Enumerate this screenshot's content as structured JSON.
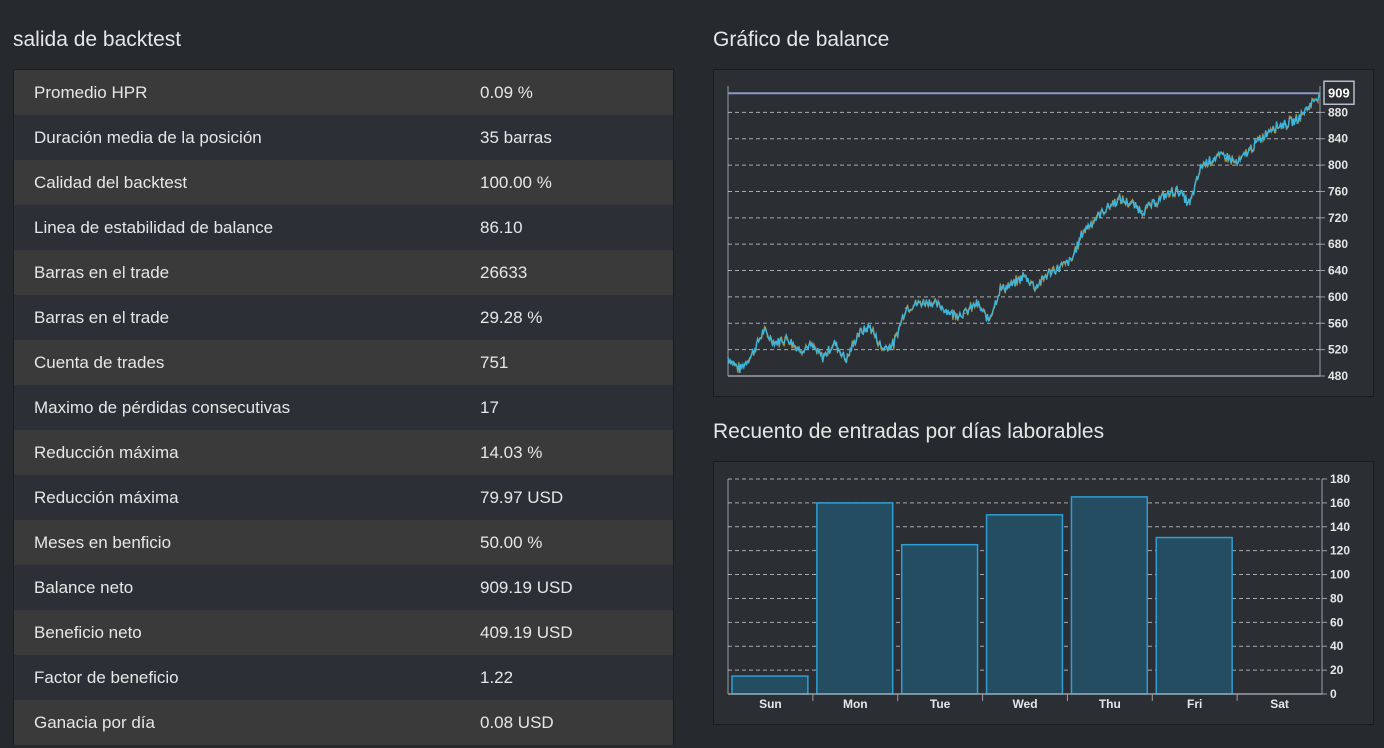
{
  "left_panel": {
    "title": "salida de backtest",
    "rows": [
      {
        "label": "Promedio HPR",
        "value": "0.09 %"
      },
      {
        "label": "Duración media de la posición",
        "value": "35 barras"
      },
      {
        "label": "Calidad del backtest",
        "value": "100.00 %"
      },
      {
        "label": "Linea de estabilidad de balance",
        "value": "86.10"
      },
      {
        "label": "Barras en el trade",
        "value": "26633"
      },
      {
        "label": "Barras en el trade",
        "value": "29.28 %"
      },
      {
        "label": "Cuenta de trades",
        "value": "751"
      },
      {
        "label": "Maximo de pérdidas consecutivas",
        "value": "17"
      },
      {
        "label": "Reducción máxima",
        "value": "14.03 %"
      },
      {
        "label": "Reducción máxima",
        "value": "79.97 USD"
      },
      {
        "label": "Meses en benficio",
        "value": "50.00 %"
      },
      {
        "label": "Balance neto",
        "value": "909.19 USD"
      },
      {
        "label": "Beneficio neto",
        "value": "409.19 USD"
      },
      {
        "label": "Factor de beneficio",
        "value": "1.22"
      },
      {
        "label": "Ganacia por día",
        "value": "0.08 USD"
      }
    ]
  },
  "chart_data": [
    {
      "type": "line",
      "title": "Gráfico de balance",
      "ylim": [
        480,
        920
      ],
      "yticks": [
        480,
        520,
        560,
        600,
        640,
        680,
        720,
        760,
        800,
        840,
        880
      ],
      "grid": true,
      "last_value_label": "909",
      "last_value": 909,
      "line_color": "#3cb6dc",
      "noise_color": "#d89a2e",
      "x": [
        0,
        2,
        4,
        6,
        8,
        10,
        12,
        14,
        16,
        18,
        20,
        22,
        24,
        26,
        28,
        30,
        32,
        34,
        36,
        38,
        40,
        42,
        44,
        46,
        48,
        50,
        52,
        54,
        56,
        58,
        60,
        62,
        64,
        66,
        68,
        70,
        72,
        74,
        76,
        78,
        80,
        82,
        84,
        86,
        88,
        90,
        92,
        94,
        96,
        98,
        100
      ],
      "y": [
        508,
        490,
        512,
        548,
        530,
        538,
        520,
        526,
        508,
        530,
        505,
        544,
        555,
        522,
        528,
        583,
        590,
        593,
        585,
        574,
        575,
        590,
        565,
        612,
        618,
        632,
        615,
        635,
        645,
        655,
        700,
        718,
        735,
        748,
        742,
        730,
        742,
        755,
        762,
        740,
        800,
        810,
        815,
        802,
        822,
        840,
        858,
        862,
        868,
        888,
        909
      ]
    },
    {
      "type": "bar",
      "title": "Recuento de entradas por días laborables",
      "categories": [
        "Sun",
        "Mon",
        "Tue",
        "Wed",
        "Thu",
        "Fri",
        "Sat"
      ],
      "values": [
        15,
        160,
        125,
        150,
        165,
        131,
        0
      ],
      "ylim": [
        0,
        180
      ],
      "yticks": [
        0,
        20,
        40,
        60,
        80,
        100,
        120,
        140,
        160,
        180
      ],
      "grid": true,
      "bar_color": "#2d9fd6",
      "bar_fill": "#244d61"
    }
  ]
}
